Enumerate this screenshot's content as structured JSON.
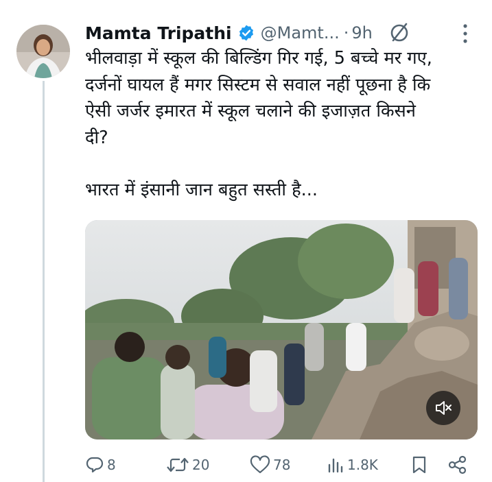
{
  "tweet": {
    "author_name": "Mamta Tripathi",
    "handle": "@Mamt...",
    "separator": "·",
    "time": "9h",
    "text_lines": [
      "भीलवाड़ा में स्कूल की बिल्डिंग गिर गई, 5 बच्चे मर गए,",
      "दर्जनों घायल हैं मगर सिस्टम से सवाल नहीं पूछना है कि",
      "ऐसी जर्जर इमारत में स्कूल चलाने की इजाज़त किसने",
      "दी?"
    ],
    "text_second_paragraph": "भारत में इंसानी जान बहुत सस्ती है...",
    "media": {
      "type": "video",
      "muted": true
    }
  },
  "actions": {
    "replies": "8",
    "retweets": "20",
    "likes": "78",
    "views": "1.8K"
  },
  "colors": {
    "verified_blue": "#1d9bf0",
    "muted_text": "#536471",
    "thread_line": "#cfd9de"
  },
  "icons": [
    "verified-badge-icon",
    "no-entry-icon",
    "more-options-icon",
    "mute-icon",
    "reply-icon",
    "retweet-icon",
    "like-icon",
    "views-icon",
    "bookmark-icon",
    "share-icon"
  ]
}
